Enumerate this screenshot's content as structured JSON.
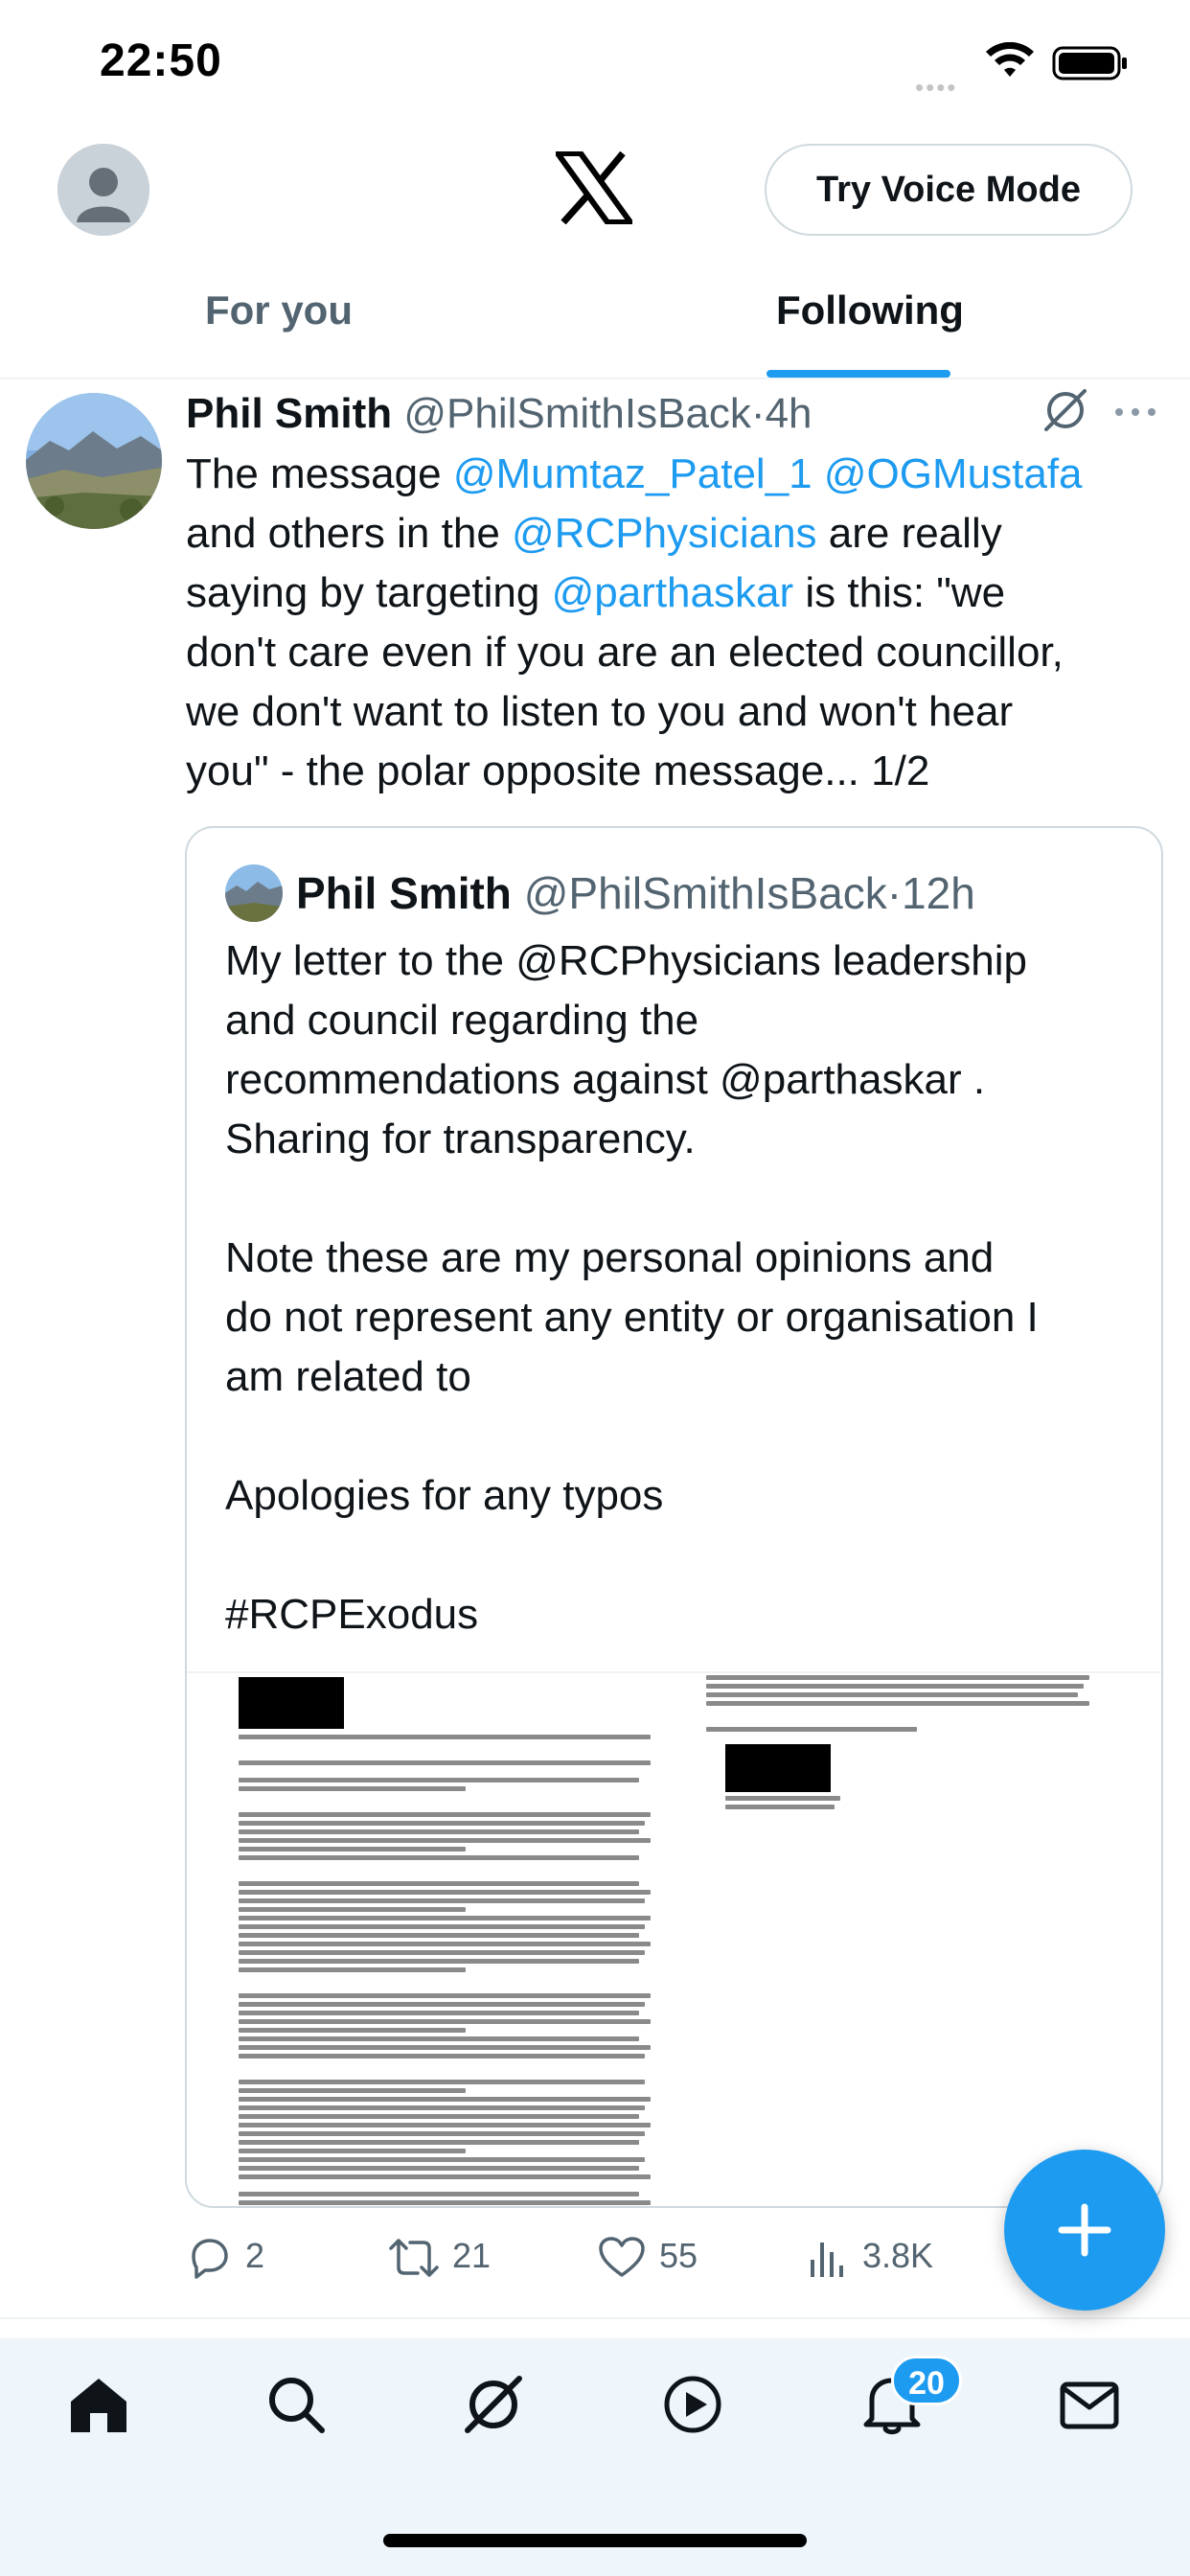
{
  "status_bar": {
    "time": "22:50",
    "signal_dots": "••••"
  },
  "header": {
    "voice_button_label": "Try Voice Mode"
  },
  "tabs": [
    {
      "label": "For you",
      "active": false
    },
    {
      "label": "Following",
      "active": true
    }
  ],
  "tweet": {
    "author_name": "Phil Smith",
    "author_handle": "@PhilSmithIsBack",
    "separator": "·",
    "time": "4h",
    "text_parts": [
      {
        "text": "The message ",
        "mention": false
      },
      {
        "text": "@Mumtaz_Patel_1",
        "mention": true
      },
      {
        "text": " ",
        "mention": false
      },
      {
        "text": "@OGMustafa",
        "mention": true
      },
      {
        "text": "\nand others in the ",
        "mention": false
      },
      {
        "text": "@RCPhysicians",
        "mention": true
      },
      {
        "text": " are really\nsaying by targeting ",
        "mention": false
      },
      {
        "text": "@parthaskar",
        "mention": true
      },
      {
        "text": " is this: \"we\ndon't care even if you are an elected councillor,\nwe don't want to listen to you and won't hear\nyou\" - the polar opposite message... 1/2",
        "mention": false
      }
    ],
    "quote": {
      "author_name": "Phil Smith",
      "author_handle": "@PhilSmithIsBack",
      "separator": "·",
      "time": "12h",
      "text": "My letter to the @RCPhysicians leadership\nand council regarding the\nrecommendations against @parthaskar .\nSharing for transparency.\n\nNote these are my personal opinions and\ndo not represent any entity or organisation I\nam related to\n\nApologies for any typos\n\n#RCPExodus"
    },
    "actions": {
      "replies": "2",
      "reposts": "21",
      "likes": "55",
      "views": "3.8K"
    }
  },
  "bottom_nav": {
    "items": [
      "home-icon",
      "search-icon",
      "grok-icon",
      "video-icon",
      "notifications-icon",
      "messages-icon"
    ],
    "notifications_badge": "20"
  },
  "colors": {
    "accent": "#1d9bf0",
    "text_primary": "#0f1419",
    "text_secondary": "#536471",
    "border": "#cfd9de"
  }
}
